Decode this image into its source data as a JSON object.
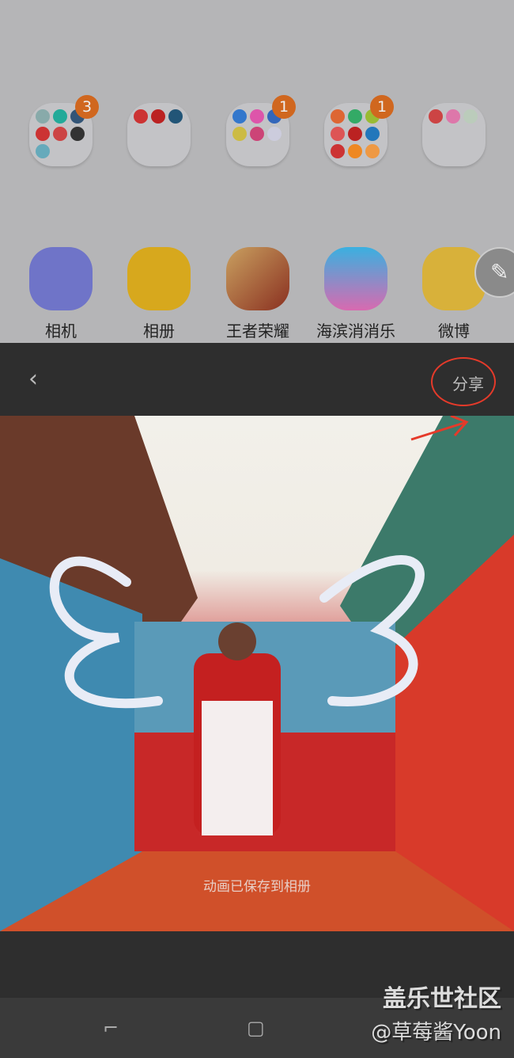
{
  "home": {
    "folders": [
      {
        "badge": "3"
      },
      {
        "badge": null
      },
      {
        "badge": "1"
      },
      {
        "badge": "1"
      },
      {
        "badge": null
      }
    ],
    "apps": [
      {
        "label": "相机",
        "color": "#6f74c8"
      },
      {
        "label": "相册",
        "color": "#d7a81d"
      },
      {
        "label": "王者荣耀",
        "color": "#a5432c"
      },
      {
        "label": "海滨消消乐",
        "color": "#d86ab0"
      },
      {
        "label": "微博",
        "color": "#d8b13a"
      }
    ],
    "edit_icon": "pen-icon"
  },
  "viewer": {
    "back_icon": "chevron-left-icon",
    "share_label": "分享",
    "toast": "动画已保存到相册"
  },
  "watermark": {
    "line1": "盖乐世社区",
    "line2": "@草莓酱Yoon"
  },
  "annotation_color": "#e53a2a"
}
